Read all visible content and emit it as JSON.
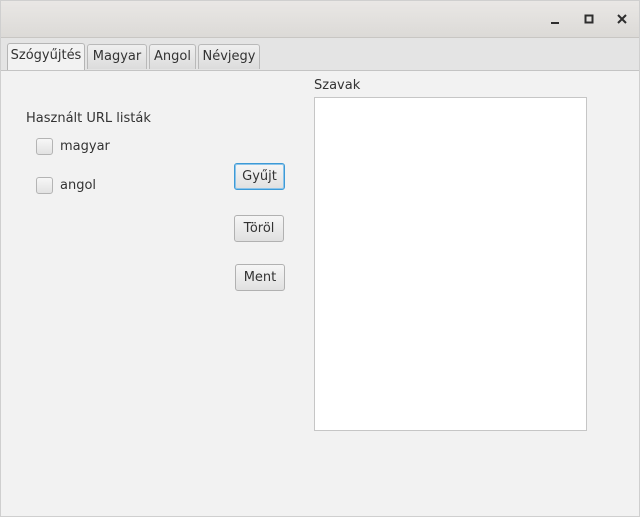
{
  "window": {
    "controls": {
      "minimize_icon": "minimize-icon",
      "maximize_icon": "maximize-icon",
      "close_icon": "close-icon"
    }
  },
  "tabs": [
    {
      "label": "Szógyűjtés",
      "active": true
    },
    {
      "label": "Magyar",
      "active": false
    },
    {
      "label": "Angol",
      "active": false
    },
    {
      "label": "Névjegy",
      "active": false
    }
  ],
  "main": {
    "url_lists_label": "Használt URL listák",
    "checkboxes": [
      {
        "label": "magyar",
        "checked": false
      },
      {
        "label": "angol",
        "checked": false
      }
    ],
    "buttons": {
      "collect": "Gyűjt",
      "delete": "Töröl",
      "save": "Ment"
    },
    "words_label": "Szavak",
    "words_value": ""
  },
  "colors": {
    "focus_border": "#3d9ad6",
    "background": "#f2f2f2"
  }
}
